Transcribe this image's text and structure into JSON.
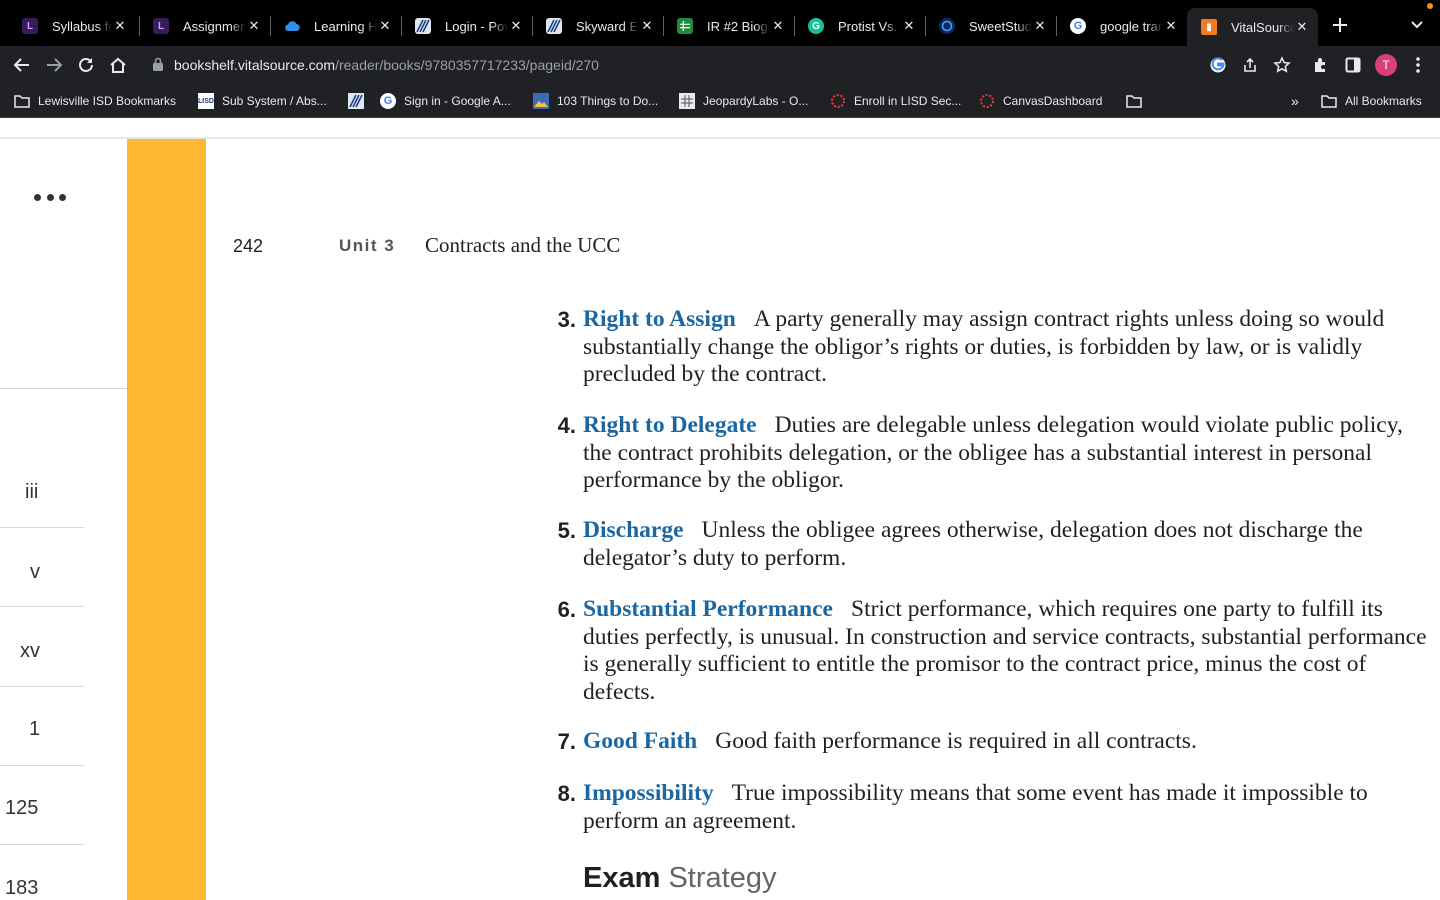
{
  "browser": {
    "tabs": [
      {
        "title": "Syllabus fo",
        "favicon": "lisd-icon",
        "active": false
      },
      {
        "title": "Assignmen",
        "favicon": "lisd-icon",
        "active": false
      },
      {
        "title": "Learning H",
        "favicon": "cloud-icon",
        "active": false
      },
      {
        "title": "Login - Pov",
        "favicon": "skyward-icon",
        "active": false
      },
      {
        "title": "Skyward Ed",
        "favicon": "skyward-icon",
        "active": false
      },
      {
        "title": "IR #2 Biogr",
        "favicon": "sheets-icon",
        "active": false
      },
      {
        "title": "Protist Vs.",
        "favicon": "grammarly-icon",
        "active": false
      },
      {
        "title": "SweetStud",
        "favicon": "sweetstudy-icon",
        "active": false
      },
      {
        "title": "google tran",
        "favicon": "google-icon",
        "active": false
      },
      {
        "title": "VitalSource",
        "favicon": "vitalsource-icon",
        "active": true
      }
    ],
    "url_host": "bookshelf.vitalsource.com",
    "url_path": "/reader/books/9780357717233/pageid/270",
    "avatar_initial": "T",
    "bookmarks": [
      {
        "label": "Lewisville ISD Bookmarks",
        "icon": "folder-icon"
      },
      {
        "label": "Sub System / Abs...",
        "icon": "lisd-icon"
      },
      {
        "label": "",
        "icon": "skyward-icon"
      },
      {
        "label": "Sign in - Google A...",
        "icon": "google-icon"
      },
      {
        "label": "103 Things to Do...",
        "icon": "image-icon"
      },
      {
        "label": "JeopardyLabs - O...",
        "icon": "jeopardy-icon"
      },
      {
        "label": "Enroll in LISD Sec...",
        "icon": "ring-icon"
      },
      {
        "label": "CanvasDashboard",
        "icon": "ring-icon"
      },
      {
        "label": "",
        "icon": "folder-icon"
      }
    ],
    "overflow_label": "»",
    "all_bookmarks_label": "All Bookmarks"
  },
  "sidebar": {
    "toc_pages": [
      "iii",
      "v",
      "xv",
      "1",
      "125",
      "183"
    ]
  },
  "page": {
    "number": "242",
    "unit_label": "Unit 3",
    "chapter_title": "Contracts and the UCC",
    "items": [
      {
        "num": "3.",
        "term": "Right to Assign",
        "text": "A party generally may assign contract rights unless doing so would substantially change the obligor’s rights or duties, is forbidden by law, or is validly precluded by the contract."
      },
      {
        "num": "4.",
        "term": "Right to Delegate",
        "text": "Duties are delegable unless delegation would violate public policy, the contract prohibits delegation, or the obligee has a substantial interest in personal performance by the obligor."
      },
      {
        "num": "5.",
        "term": "Discharge",
        "text": "Unless the obligee agrees otherwise, delegation does not discharge the delegator’s duty to perform."
      },
      {
        "num": "6.",
        "term": "Substantial Performance",
        "text": "Strict performance, which requires one party to fulfill its duties perfectly, is unusual. In construction and service contracts, substantial performance is generally sufficient to entitle the promisor to the contract price, minus the cost of defects."
      },
      {
        "num": "7.",
        "term": "Good Faith",
        "text": "Good faith performance is required in all contracts."
      },
      {
        "num": "8.",
        "term": "Impossibility",
        "text": "True impossibility means that some event has made it impossible to perform an agreement."
      }
    ],
    "exam_bold": "Exam",
    "exam_light": "Strategy"
  },
  "colors": {
    "accent_orange": "#fdb733",
    "term_blue": "#1a67a3",
    "chrome_dark": "#202124"
  }
}
